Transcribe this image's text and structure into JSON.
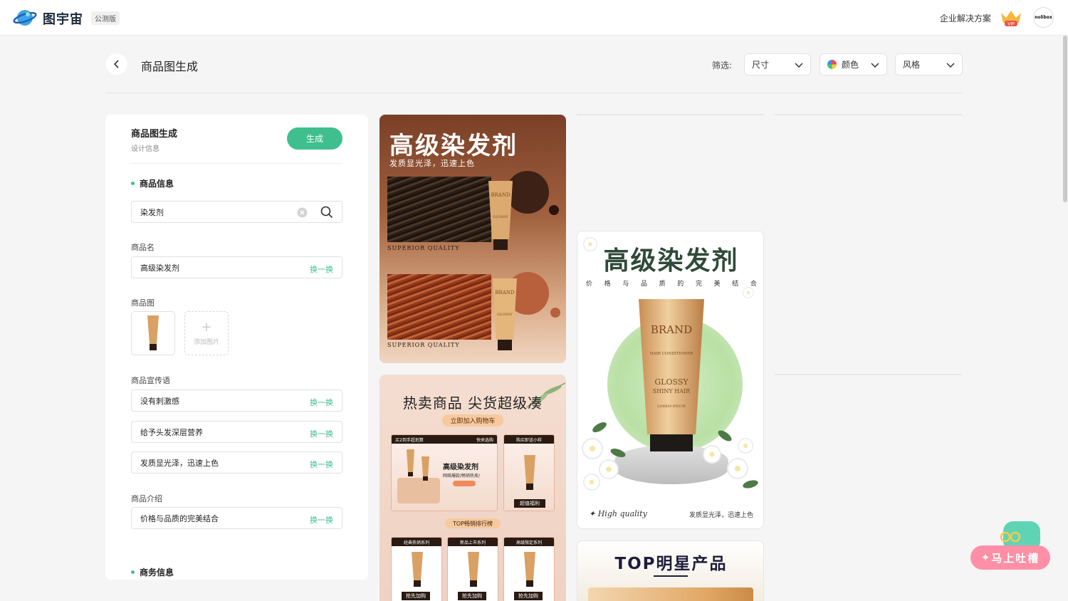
{
  "app": {
    "name": "图宇宙",
    "badge": "公测版"
  },
  "topbar": {
    "enterprise_label": "企业解决方案",
    "vip_badge": "VIP",
    "avatar_text": "nolibox"
  },
  "header": {
    "title": "商品图生成",
    "filter_label": "筛选:",
    "filters": [
      "尺寸",
      "颜色",
      "风格"
    ]
  },
  "panel": {
    "title": "商品图生成",
    "subtitle": "设计信息",
    "generate_label": "生成",
    "section_product": "商品信息",
    "search_value": "染发剂",
    "name_label": "商品名",
    "name_value": "高级染发剂",
    "swap_label": "换一换",
    "image_label": "商品图",
    "add_image_label": "添加图片",
    "slogan_label": "商品宣传语",
    "slogans": [
      "没有刺激感",
      "给予头发深层营养",
      "发质显光泽，迅速上色"
    ],
    "intro_label": "商品介绍",
    "intro_value": "价格与品质的完美结合",
    "section_business": "商务信息"
  },
  "cards": {
    "card1": {
      "title": "高级染发剂",
      "subtitle": "发质显光泽，迅速上色",
      "quality": "SUPERIOR QUALITY",
      "tube_brand": "BRAND",
      "tube_text": "GLOSSY"
    },
    "card2": {
      "title": "热卖商品 尖货超级凑",
      "pill": "立即加入购物车",
      "promo_left_a": "买2到手超划算",
      "promo_left_b": "快来选购",
      "promo_right": "购买即送小样",
      "product_name": "高级染发剂",
      "product_desc": "网络爆款/畅销热卖/",
      "tag": "超值福利",
      "ranking": "TOP畅销排行榜",
      "series": [
        "经典热销系列",
        "新品上市系列",
        "高级限定系列"
      ],
      "buy_label": "抢先加购"
    },
    "card3": {
      "title": "高级染发剂",
      "subtitle_chars": [
        "价",
        "格",
        "与",
        "品",
        "质",
        "的",
        "完",
        "美",
        "结",
        "合"
      ],
      "tube_brand": "BRAND",
      "tube_sub": "HAIR CONDITIONER",
      "tube_glossy": "GLOSSY",
      "tube_shiny": "SHINY HAIR",
      "tube_lorem": "LOREM IPSUM",
      "footer_left": "High quality",
      "footer_right": "发质显光泽，迅速上色"
    },
    "card4": {
      "title": "TOP明星产品"
    }
  },
  "feedback": {
    "label": "马上吐槽"
  },
  "colors": {
    "accent": "#3fbf8e",
    "feedback": "#ff8fa6"
  }
}
